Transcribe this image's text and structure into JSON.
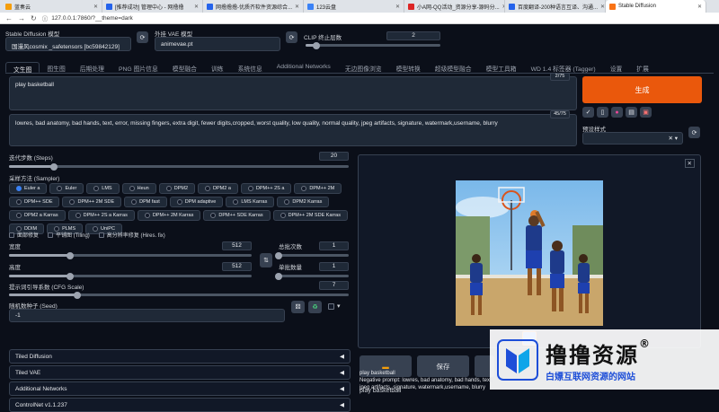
{
  "browser": {
    "tabs": [
      {
        "label": "蓝奏云",
        "color": "#f59e0b"
      },
      {
        "label": "[推荐成功] 管理中心 - 网撸撸",
        "color": "#2563eb"
      },
      {
        "label": "网撸撸撸-优质齐软件资源综合...",
        "color": "#2563eb"
      },
      {
        "label": "123云盘",
        "color": "#3b82f6"
      },
      {
        "label": "小A网-QQ活动_资源分享-源码分...",
        "color": "#dc2626"
      },
      {
        "label": "百度翻译-200种语言互译、沟通...",
        "color": "#2563eb"
      },
      {
        "label": "Stable Diffusion",
        "color": "#f97316"
      }
    ],
    "url": "127.0.0.1:7860/?__theme=dark",
    "security": "ⓘ"
  },
  "top": {
    "model_label": "Stable Diffusion 模型",
    "model_value": "国漫风cosmix _safetensors [bc59842129]",
    "vae_label": "外挂 VAE 模型",
    "vae_value": "animevae.pt",
    "clip_label": "CLIP 终止层数",
    "clip_value": "2",
    "clip_fraction": 0.08
  },
  "tabs": [
    "文生图",
    "图生图",
    "后期处理",
    "PNG 图片信息",
    "模型融合",
    "训练",
    "系统信息",
    "Additional Networks",
    "无边图像浏览",
    "模型转换",
    "超级模型融合",
    "模型工具箱",
    "WD 1.4 标签器 (Tagger)",
    "设置",
    "扩展"
  ],
  "prompt": {
    "positive": "play basketball",
    "positive_count": "2/75",
    "negative": "lowres, bad anatomy, bad hands, text, error, missing fingers, extra digit, fewer digits,cropped, worst quality, low quality, normal quality, jpeg artifacts, signature, watermark,username, blurry",
    "negative_count": "45/75"
  },
  "generate_label": "生成",
  "style_label": "预设样式",
  "steps": {
    "label": "迭代步数 (Steps)",
    "value": "20",
    "fraction": 0.133
  },
  "sampler": {
    "label": "采样方法 (Sampler)",
    "options": [
      "Euler a",
      "Euler",
      "LMS",
      "Heun",
      "DPM2",
      "DPM2 a",
      "DPM++ 2S a",
      "DPM++ 2M",
      "DPM++ SDE",
      "DPM++ 2M SDE",
      "DPM fast",
      "DPM adaptive",
      "LMS Karras",
      "DPM2 Karras",
      "DPM2 a Karras",
      "DPM++ 2S a Karras",
      "DPM++ 2M Karras",
      "DPM++ SDE Karras",
      "DPM++ 2M SDE Karras",
      "DDIM",
      "PLMS",
      "UniPC"
    ],
    "selected": "Euler a"
  },
  "checks": [
    "面部修复",
    "平铺图 (Tiling)",
    "高分辨率修复 (Hires. fix)"
  ],
  "width": {
    "label": "宽度",
    "value": "512",
    "fraction": 0.25
  },
  "height": {
    "label": "高度",
    "value": "512",
    "fraction": 0.25
  },
  "batch_count": {
    "label": "总批次数",
    "value": "1",
    "fraction": 0.0
  },
  "batch_size": {
    "label": "单批数量",
    "value": "1",
    "fraction": 0.0
  },
  "cfg": {
    "label": "提示词引导系数 (CFG Scale)",
    "value": "7",
    "fraction": 0.2
  },
  "seed": {
    "label": "随机数种子 (Seed)",
    "value": "-1"
  },
  "accordions": [
    "Tiled Diffusion",
    "Tiled VAE",
    "Additional Networks",
    "ControlNet v1.1.237"
  ],
  "output": {
    "caption": "play basketball",
    "neg_line": "Negative prompt: lowres, bad anatomy, bad hands, text, e",
    "neg_line2": "jpeg artifacts, signature, watermark,username, blurry",
    "save_label": "保存"
  },
  "watermark": {
    "title": "撸撸资源",
    "sub": "白嫖互联网资源的网站",
    "reg": "®"
  }
}
